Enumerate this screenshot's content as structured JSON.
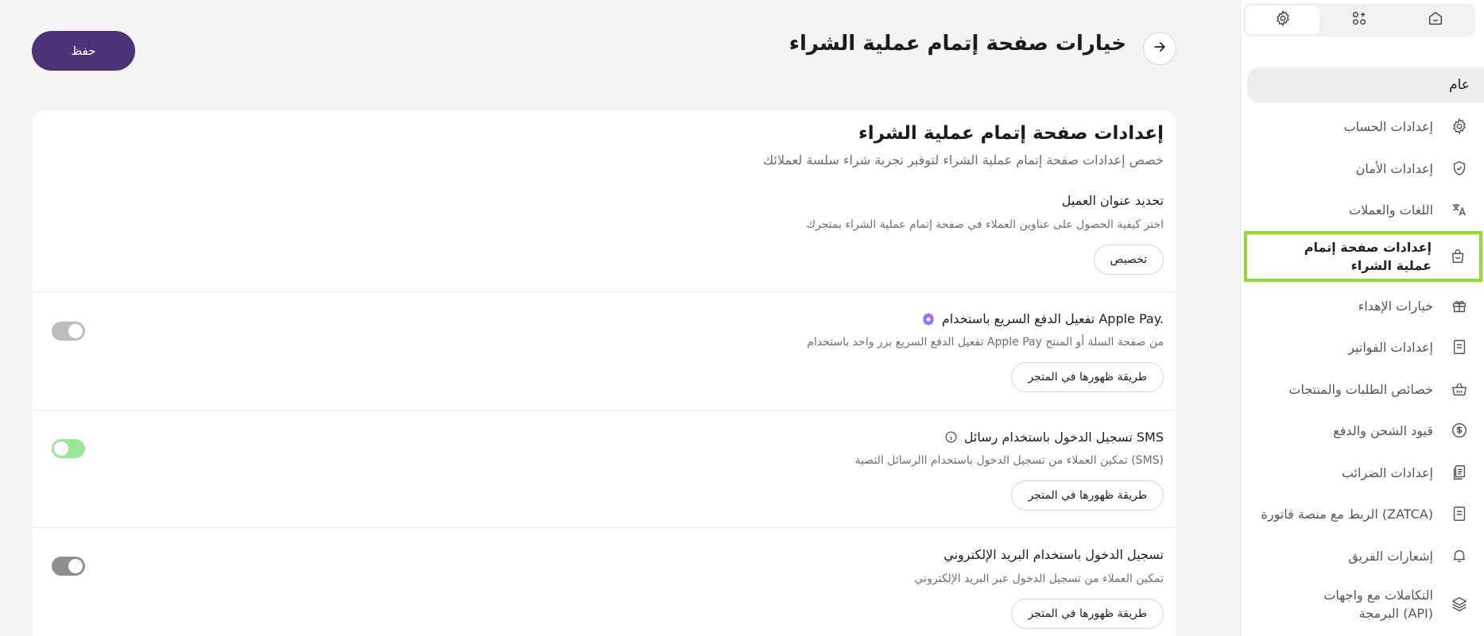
{
  "sidebar": {
    "general_label": "عام",
    "items": [
      {
        "label": "إعدادات الحساب",
        "icon": "gear-icon"
      },
      {
        "label": "إعدادات الأمان",
        "icon": "shield-icon"
      },
      {
        "label": "اللغات والعملات",
        "icon": "translate-icon"
      },
      {
        "label": "إعدادات صفحة إتمام عملية الشراء",
        "icon": "shopping-bag-icon",
        "active": true
      },
      {
        "label": "خيارات الإهداء",
        "icon": "gift-icon"
      },
      {
        "label": "إعدادات الفواتير",
        "icon": "invoice-icon"
      },
      {
        "label": "خصائص الطلبات والمنتجات",
        "icon": "basket-icon"
      },
      {
        "label": "قيود الشحن والدفع",
        "icon": "dollar-circle-icon"
      },
      {
        "label": "إعدادات الضرائب",
        "icon": "tax-document-icon"
      },
      {
        "label": "الربط مع منصة فاتورة (ZATCA)",
        "icon": "receipt-icon"
      },
      {
        "label": "إشعارات الفريق",
        "icon": "bell-icon"
      },
      {
        "label": "التكاملات مع واجهات البرمجة (API)",
        "icon": "layers-icon"
      }
    ]
  },
  "header": {
    "title": "خيارات صفحة إتمام عملية الشراء",
    "save_label": "حفظ"
  },
  "card": {
    "title": "إعدادات صفحة إتمام عملية الشراء",
    "subtitle": "خصص إعدادات صفحة إتمام عملية الشراء لتوفير تجربة شراء سلسة لعملائك"
  },
  "sections": {
    "address": {
      "title": "تحديد عنوان العميل",
      "desc": "اختر كيفية الحصول على عناوين العملاء في صفحة إتمام عملية الشراء بمتجرك",
      "button": "تخصيص"
    },
    "apple_pay": {
      "title": "تفعيل الدفع السريع باستخدام Apple Pay.",
      "desc": "تفعيل الدفع السريع بزر واحد باستخدام Apple Pay من صفحة السلة أو المنتج",
      "button": "طريقة ظهورها في المتجر",
      "enabled": false,
      "toggle_color": "#bdbdbd"
    },
    "sms": {
      "title": "تسجيل الدخول باستخدام رسائل SMS",
      "desc": "تمكين العملاء من تسجيل الدخول باستخدام االرسائل النصية (SMS)",
      "button": "طريقة ظهورها في المتجر",
      "enabled": true,
      "toggle_color": "#9be59a"
    },
    "email": {
      "title": "تسجيل الدخول باستخدام البريد الإلكتروني",
      "desc": "تمكين العملاء من تسجيل الدخول عبر البريد الإلكتروني",
      "button": "طريقة ظهورها في المتجر",
      "enabled": false,
      "toggle_color": "#8f8f8f"
    }
  },
  "colors": {
    "accent": "#4e3276",
    "highlight": "#8fdc2a",
    "badge": "#9b6cf0"
  }
}
